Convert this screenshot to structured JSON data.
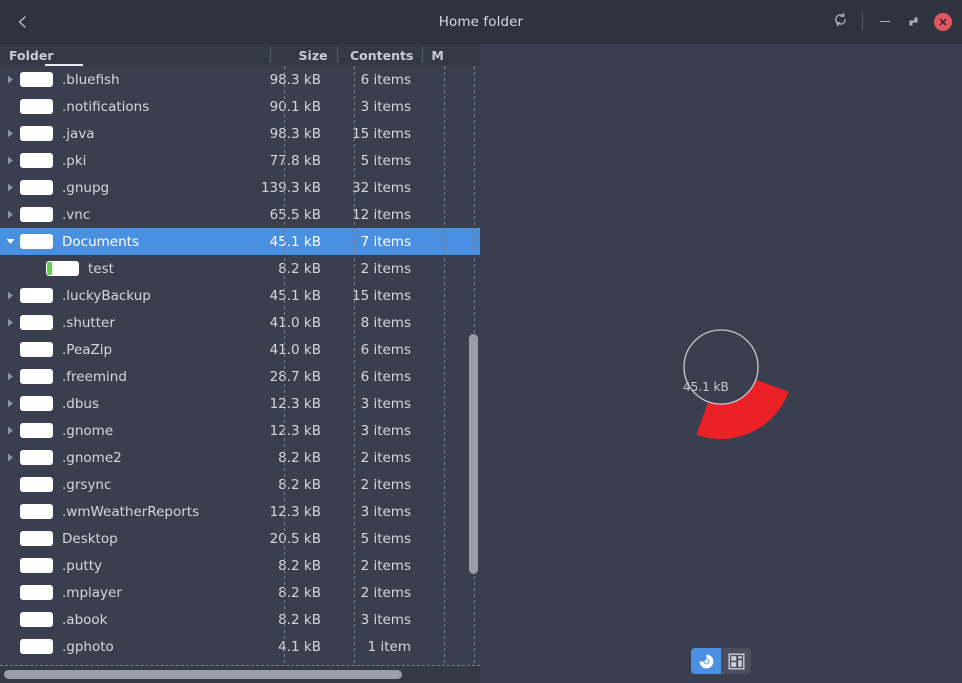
{
  "window": {
    "title": "Home folder",
    "back_icon": "chevron-left-icon",
    "refresh_icon": "refresh-icon",
    "minimize_label": "–",
    "maximize_icon": "maximize-icon",
    "close_icon": "close-icon",
    "close_color": "#e05561"
  },
  "colors": {
    "titlebar_bg": "#2f333f",
    "pane_bg": "#3a3f50",
    "header_bg": "#343948",
    "selection": "#4a90e2",
    "accent_red": "#ec2027",
    "accent_green": "#5fd34a",
    "text": "#d2d7e0",
    "scrollbar": "#989eac"
  },
  "list": {
    "columns": [
      {
        "key": "name",
        "label": "Folder"
      },
      {
        "key": "size",
        "label": "Size"
      },
      {
        "key": "contents",
        "label": "Contents"
      },
      {
        "key": "modified",
        "label": "M"
      }
    ],
    "sorted_column": "Folder",
    "rows": [
      {
        "name": ".bluefish",
        "size": "98.3 kB",
        "contents": "6 items",
        "modified": "",
        "indent": 0,
        "twisty": "collapsed",
        "selected": false,
        "icon": "folder-icon"
      },
      {
        "name": ".notifications",
        "size": "90.1 kB",
        "contents": "3 items",
        "modified": "",
        "indent": 0,
        "twisty": "none",
        "selected": false,
        "icon": "folder-icon"
      },
      {
        "name": ".java",
        "size": "98.3 kB",
        "contents": "15 items",
        "modified": "",
        "indent": 0,
        "twisty": "collapsed",
        "selected": false,
        "icon": "folder-icon"
      },
      {
        "name": ".pki",
        "size": "77.8 kB",
        "contents": "5 items",
        "modified": "",
        "indent": 0,
        "twisty": "collapsed",
        "selected": false,
        "icon": "folder-icon"
      },
      {
        "name": ".gnupg",
        "size": "139.3 kB",
        "contents": "32 items",
        "modified": "",
        "indent": 0,
        "twisty": "collapsed",
        "selected": false,
        "icon": "folder-icon"
      },
      {
        "name": ".vnc",
        "size": "65.5 kB",
        "contents": "12 items",
        "modified": "",
        "indent": 0,
        "twisty": "collapsed",
        "selected": false,
        "icon": "folder-icon"
      },
      {
        "name": "Documents",
        "size": "45.1 kB",
        "contents": "7 items",
        "modified": "",
        "indent": 0,
        "twisty": "expanded",
        "selected": true,
        "icon": "folder-icon"
      },
      {
        "name": "test",
        "size": "8.2 kB",
        "contents": "2 items",
        "modified": "",
        "indent": 1,
        "twisty": "none",
        "selected": false,
        "icon": "folder-icon-green"
      },
      {
        "name": ".luckyBackup",
        "size": "45.1 kB",
        "contents": "15 items",
        "modified": "",
        "indent": 0,
        "twisty": "collapsed",
        "selected": false,
        "icon": "folder-icon"
      },
      {
        "name": ".shutter",
        "size": "41.0 kB",
        "contents": "8 items",
        "modified": "",
        "indent": 0,
        "twisty": "collapsed",
        "selected": false,
        "icon": "folder-icon"
      },
      {
        "name": ".PeaZip",
        "size": "41.0 kB",
        "contents": "6 items",
        "modified": "",
        "indent": 0,
        "twisty": "none",
        "selected": false,
        "icon": "folder-icon"
      },
      {
        "name": ".freemind",
        "size": "28.7 kB",
        "contents": "6 items",
        "modified": "",
        "indent": 0,
        "twisty": "collapsed",
        "selected": false,
        "icon": "folder-icon"
      },
      {
        "name": ".dbus",
        "size": "12.3 kB",
        "contents": "3 items",
        "modified": "",
        "indent": 0,
        "twisty": "collapsed",
        "selected": false,
        "icon": "folder-icon"
      },
      {
        "name": ".gnome",
        "size": "12.3 kB",
        "contents": "3 items",
        "modified": "",
        "indent": 0,
        "twisty": "collapsed",
        "selected": false,
        "icon": "folder-icon"
      },
      {
        "name": ".gnome2",
        "size": "8.2 kB",
        "contents": "2 items",
        "modified": "",
        "indent": 0,
        "twisty": "collapsed",
        "selected": false,
        "icon": "folder-icon"
      },
      {
        "name": ".grsync",
        "size": "8.2 kB",
        "contents": "2 items",
        "modified": "",
        "indent": 0,
        "twisty": "none",
        "selected": false,
        "icon": "folder-icon"
      },
      {
        "name": ".wmWeatherReports",
        "size": "12.3 kB",
        "contents": "3 items",
        "modified": "",
        "indent": 0,
        "twisty": "none",
        "selected": false,
        "icon": "folder-icon"
      },
      {
        "name": "Desktop",
        "size": "20.5 kB",
        "contents": "5 items",
        "modified": "",
        "indent": 0,
        "twisty": "none",
        "selected": false,
        "icon": "folder-icon"
      },
      {
        "name": ".putty",
        "size": "8.2 kB",
        "contents": "2 items",
        "modified": "",
        "indent": 0,
        "twisty": "none",
        "selected": false,
        "icon": "folder-icon"
      },
      {
        "name": ".mplayer",
        "size": "8.2 kB",
        "contents": "2 items",
        "modified": "",
        "indent": 0,
        "twisty": "none",
        "selected": false,
        "icon": "folder-icon"
      },
      {
        "name": ".abook",
        "size": "8.2 kB",
        "contents": "3 items",
        "modified": "",
        "indent": 0,
        "twisty": "none",
        "selected": false,
        "icon": "folder-icon"
      },
      {
        "name": ".gphoto",
        "size": "4.1 kB",
        "contents": "1 item",
        "modified": "",
        "indent": 0,
        "twisty": "none",
        "selected": false,
        "icon": "folder-icon"
      }
    ]
  },
  "chart": {
    "center_label": "45.1 kB",
    "ring_stroke": "#c4cad6",
    "segment_color": "#ec2027"
  },
  "chart_data": {
    "type": "pie",
    "title": "",
    "subtitle": "",
    "center_label": "45.1 kB",
    "inner_radius": 37,
    "outer_radius": 72,
    "legend_position": "none",
    "grid": false,
    "slices": [
      {
        "name": "Documents",
        "value": 45.1,
        "unit": "kB",
        "start_angle_deg": 20,
        "end_angle_deg": 110,
        "color": "#ec2027"
      }
    ]
  },
  "toolbar": {
    "ring_view_label": "ring-chart-view",
    "treemap_view_label": "treemap-view",
    "active_view": "ring-chart-view"
  }
}
